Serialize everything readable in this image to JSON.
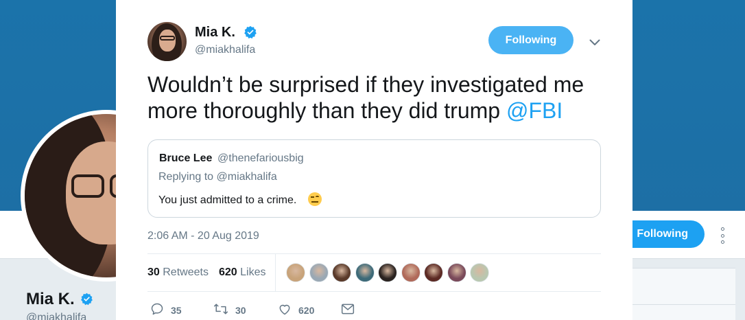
{
  "background_profile": {
    "name": "Mia K.",
    "handle": "@miakhalifa",
    "follow_label": "Following"
  },
  "tweet": {
    "author_name": "Mia K.",
    "author_handle": "@miakhalifa",
    "follow_label": "Following",
    "text_before": "Wouldn’t be surprised if they investigated me more thoroughly than they did trump ",
    "mention": "@FBI",
    "timestamp": "2:06 AM - 20 Aug 2019",
    "retweets_count": "30",
    "retweets_label": "Retweets",
    "likes_count": "620",
    "likes_label": "Likes",
    "liker_avatar_colors": [
      "#c8a37a",
      "#9aa8b4",
      "#5a3a2a",
      "#3d6a78",
      "#2b2320",
      "#b06a5a",
      "#5c2a24",
      "#7a4a5a",
      "#b9c7b0"
    ],
    "actions": {
      "reply_count": "35",
      "retweet_count": "30",
      "like_count": "620"
    }
  },
  "quoted_tweet": {
    "name": "Bruce Lee",
    "handle": "@thenefariousbig",
    "replying_to": "Replying to @miakhalifa",
    "text": "You just admitted to a crime.",
    "emoji": "face-with-raised-eyebrow"
  },
  "colors": {
    "accent": "#1da1f2",
    "follow_button": "#4ab3f4",
    "banner": "#1b73aa"
  }
}
